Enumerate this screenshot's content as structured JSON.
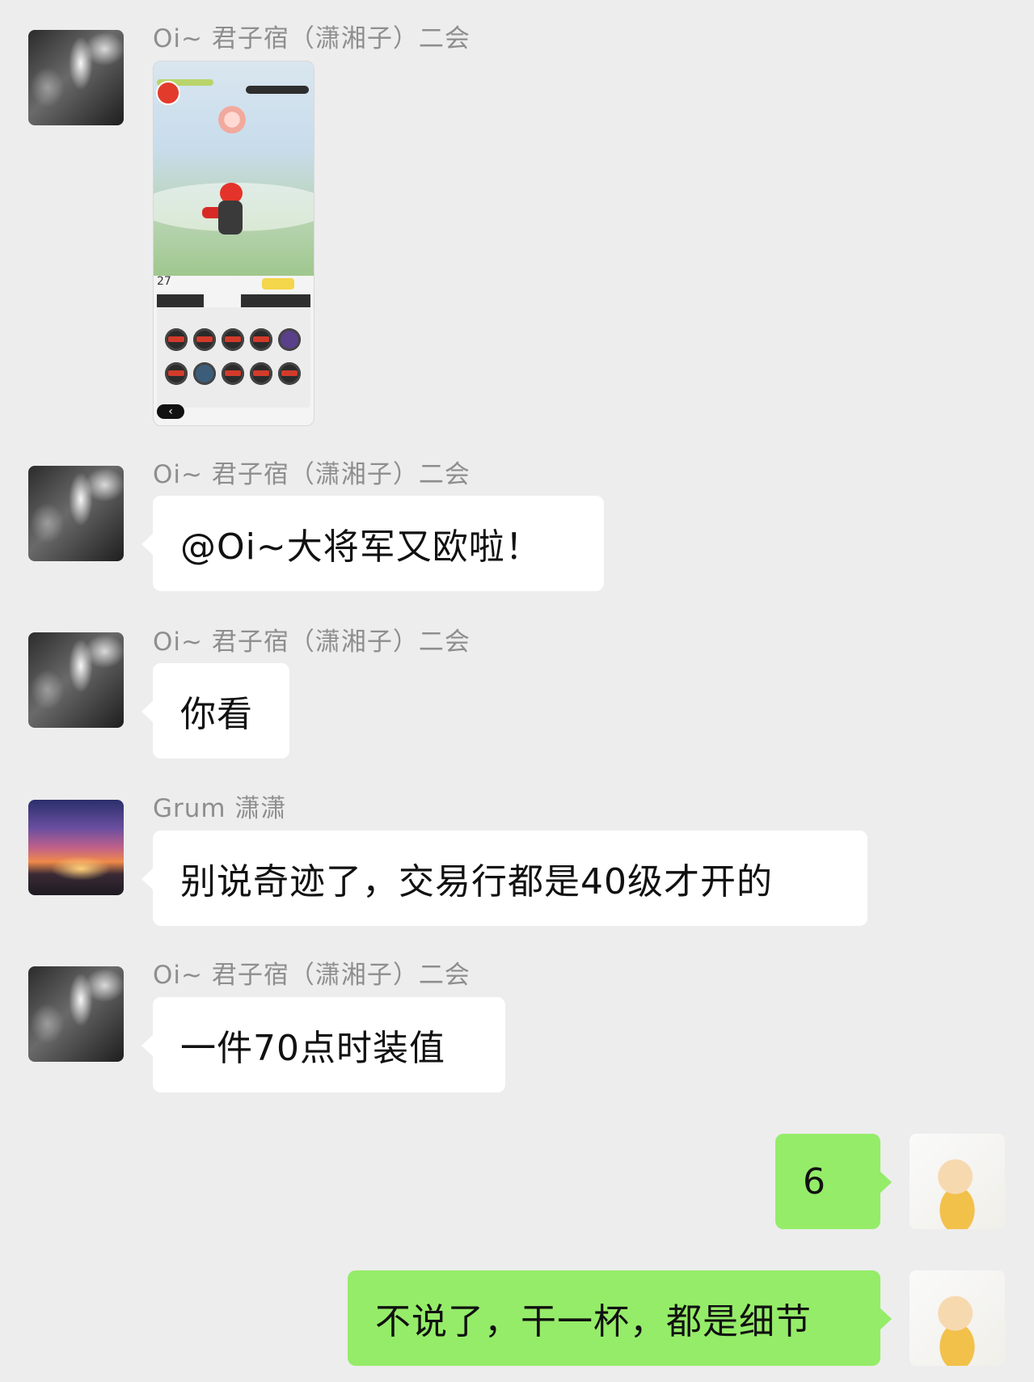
{
  "messages": [
    {
      "sender": "Oi~ 君子宿（潇湘子）二会",
      "type": "image"
    },
    {
      "sender": "Oi~ 君子宿（潇湘子）二会",
      "text": "@Oi~大将军又欧啦！"
    },
    {
      "sender": "Oi~ 君子宿（潇湘子）二会",
      "text": "你看"
    },
    {
      "sender": "Grum 潇潇",
      "text": "别说奇迹了，交易行都是40级才开的"
    },
    {
      "sender": "Oi~ 君子宿（潇湘子）二会",
      "text": "一件70点时装值"
    },
    {
      "sender": "me",
      "text": "6"
    },
    {
      "sender": "me",
      "text": "不说了，干一杯，都是细节"
    }
  ],
  "thumbnail": {
    "level": "27",
    "back_glyph": "‹"
  },
  "colors": {
    "background": "#ededed",
    "incoming_bubble": "#ffffff",
    "outgoing_bubble": "#95ec69",
    "sender_name": "#8e8e8e"
  },
  "icons": {
    "back": "chevron-left-icon"
  }
}
